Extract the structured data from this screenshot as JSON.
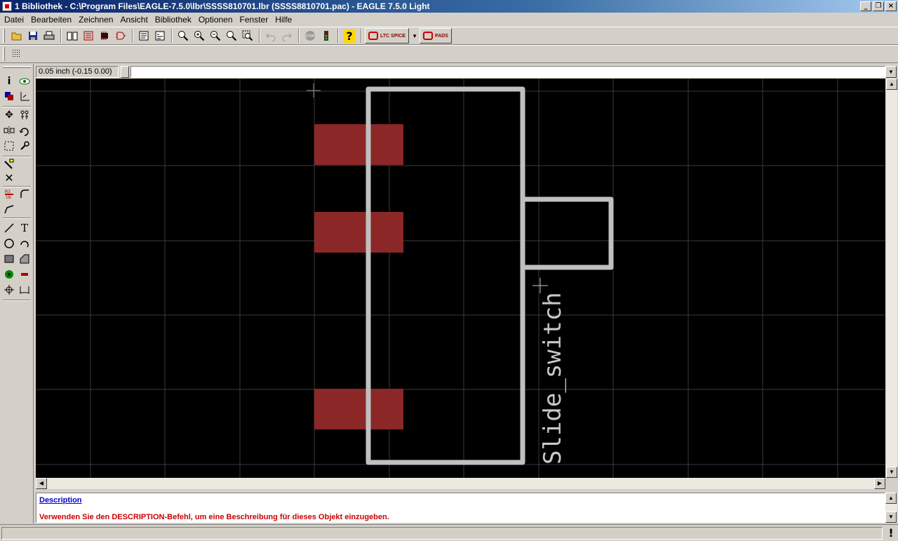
{
  "window": {
    "title": "1 Bibliothek - C:\\Program Files\\EAGLE-7.5.0\\lbr\\SSSS810701.lbr (SSSS8810701.pac) - EAGLE 7.5.0 Light",
    "minimize": "_",
    "maximize": "❐",
    "close": "×"
  },
  "menu": [
    {
      "label": "Datei"
    },
    {
      "label": "Bearbeiten"
    },
    {
      "label": "Zeichnen"
    },
    {
      "label": "Ansicht"
    },
    {
      "label": "Bibliothek"
    },
    {
      "label": "Optionen"
    },
    {
      "label": "Fenster"
    },
    {
      "label": "Hilfe"
    }
  ],
  "toolbar": {
    "ltspice_label": "LTC SPICE",
    "pads_label": "PADS",
    "help_glyph": "?",
    "stop_label": "STOP"
  },
  "commandline": {
    "coordinates": "0.05 inch (-0.15 0.00)",
    "value": "",
    "placeholder": ""
  },
  "canvas": {
    "package_name_label": "Slide_switch",
    "colors": {
      "background": "#000000",
      "grid": "#404040",
      "pad": "#8b2727",
      "outline": "#c0c0c0",
      "text": "#c8c8c8"
    }
  },
  "description": {
    "heading": "Description",
    "text": "Verwenden Sie den DESCRIPTION-Befehl, um eine Beschreibung für dieses Objekt einzugeben."
  },
  "status": {
    "message": "",
    "indicator": "!"
  }
}
